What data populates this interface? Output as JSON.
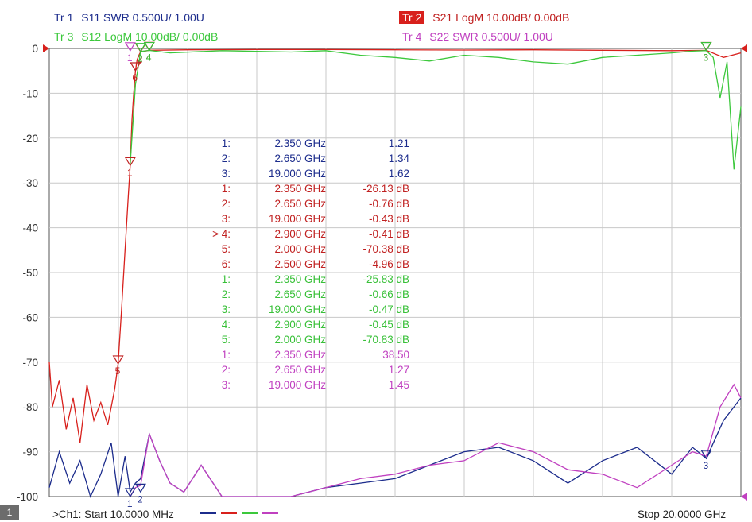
{
  "traces_header": [
    {
      "badge": "Tr",
      "num": "1",
      "label": "S11 SWR 0.500U/ 1.00U",
      "color": "#1c2c8c",
      "active": false
    },
    {
      "badge": "Tr",
      "num": "2",
      "label": "S21 LogM 10.00dB/ 0.00dB",
      "color": "#d8201c",
      "active": true
    },
    {
      "badge": "Tr",
      "num": "3",
      "label": "S12 LogM 10.00dB/ 0.00dB",
      "color": "#3cc83c",
      "active": false
    },
    {
      "badge": "Tr",
      "num": "4",
      "label": "S22 SWR 0.500U/ 1.00U",
      "color": "#c040c0",
      "active": false
    }
  ],
  "markers": [
    {
      "id": "1:",
      "freq": "2.350 GHz",
      "value": "1.21",
      "color": "#1c2c8c"
    },
    {
      "id": "2:",
      "freq": "2.650 GHz",
      "value": "1.34",
      "color": "#1c2c8c"
    },
    {
      "id": "3:",
      "freq": "19.000 GHz",
      "value": "1.62",
      "color": "#1c2c8c"
    },
    {
      "id": "1:",
      "freq": "2.350 GHz",
      "value": "-26.13 dB",
      "color": "#c02020"
    },
    {
      "id": "2:",
      "freq": "2.650 GHz",
      "value": "-0.76 dB",
      "color": "#c02020"
    },
    {
      "id": "3:",
      "freq": "19.000 GHz",
      "value": "-0.43 dB",
      "color": "#c02020"
    },
    {
      "id": "> 4:",
      "freq": "2.900 GHz",
      "value": "-0.41 dB",
      "color": "#c02020"
    },
    {
      "id": "5:",
      "freq": "2.000 GHz",
      "value": "-70.38 dB",
      "color": "#c02020"
    },
    {
      "id": "6:",
      "freq": "2.500 GHz",
      "value": "-4.96 dB",
      "color": "#c02020"
    },
    {
      "id": "1:",
      "freq": "2.350 GHz",
      "value": "-25.83 dB",
      "color": "#38c038"
    },
    {
      "id": "2:",
      "freq": "2.650 GHz",
      "value": "-0.66 dB",
      "color": "#38c038"
    },
    {
      "id": "3:",
      "freq": "19.000 GHz",
      "value": "-0.47 dB",
      "color": "#38c038"
    },
    {
      "id": "4:",
      "freq": "2.900 GHz",
      "value": "-0.45 dB",
      "color": "#38c038"
    },
    {
      "id": "5:",
      "freq": "2.000 GHz",
      "value": "-70.83 dB",
      "color": "#38c038"
    },
    {
      "id": "1:",
      "freq": "2.350 GHz",
      "value": "38.50",
      "color": "#c040c0"
    },
    {
      "id": "2:",
      "freq": "2.650 GHz",
      "value": "1.27",
      "color": "#c040c0"
    },
    {
      "id": "3:",
      "freq": "19.000 GHz",
      "value": "1.45",
      "color": "#c040c0"
    }
  ],
  "footer": {
    "channel_badge": "1",
    "start": ">Ch1:  Start  10.0000 MHz",
    "stop": "Stop  20.0000 GHz"
  },
  "chart_data": {
    "type": "line",
    "title": "",
    "xlabel": "",
    "ylabel": "",
    "x_unit": "GHz",
    "xlim": [
      0.01,
      20
    ],
    "ylim": [
      -100,
      0
    ],
    "yticks": [
      "0",
      "-10",
      "-20",
      "-30",
      "-40",
      "-50",
      "-60",
      "-70",
      "-80",
      "-90",
      "-100"
    ],
    "grid": true,
    "series": [
      {
        "name": "S21",
        "color": "#d8201c",
        "x": [
          0.01,
          0.1,
          0.3,
          0.5,
          0.7,
          0.9,
          1.1,
          1.3,
          1.5,
          1.7,
          1.9,
          2.0,
          2.1,
          2.2,
          2.3,
          2.35,
          2.4,
          2.45,
          2.5,
          2.55,
          2.6,
          2.65,
          2.9,
          4,
          6,
          8,
          10,
          12,
          14,
          16,
          18,
          19,
          19.5,
          20
        ],
        "y": [
          -70,
          -80,
          -74,
          -85,
          -78,
          -88,
          -75,
          -83,
          -79,
          -84,
          -76,
          -70.38,
          -58,
          -45,
          -32,
          -26.13,
          -16,
          -10,
          -4.96,
          -2.5,
          -1.5,
          -0.76,
          -0.41,
          -0.3,
          -0.25,
          -0.25,
          -0.3,
          -0.35,
          -0.3,
          -0.4,
          -0.5,
          -0.43,
          -2,
          -1
        ]
      },
      {
        "name": "S12",
        "color": "#3cc83c",
        "x": [
          2.35,
          2.5,
          2.65,
          2.9,
          3.5,
          5,
          7,
          8,
          9,
          10,
          11,
          12,
          13,
          14,
          15,
          16,
          17,
          18,
          18.6,
          19,
          19.2,
          19.4,
          19.6,
          19.8,
          20
        ],
        "y": [
          -25.83,
          -8,
          -0.66,
          -0.45,
          -1,
          -0.5,
          -0.8,
          -0.5,
          -1.5,
          -2,
          -2.8,
          -1.5,
          -2,
          -3,
          -3.5,
          -2,
          -1.5,
          -1,
          -0.6,
          -0.47,
          -2,
          -11,
          -3,
          -27,
          -13
        ]
      },
      {
        "name": "S11",
        "color": "#1c2c8c",
        "x": [
          0.01,
          0.3,
          0.6,
          0.9,
          1.2,
          1.5,
          1.8,
          2.0,
          2.2,
          2.35,
          2.5,
          2.65,
          2.9,
          3.2,
          3.5,
          3.9,
          4.4,
          5,
          6,
          7,
          8,
          9,
          10,
          11,
          12,
          13,
          14,
          15,
          16,
          17,
          18,
          18.6,
          19,
          19.5,
          20
        ],
        "y": [
          -98,
          -90,
          -97,
          -92,
          -100,
          -95,
          -88,
          -100,
          -91,
          -99,
          -97,
          -96,
          -86,
          -92,
          -97,
          -99,
          -93,
          -100,
          -100,
          -100,
          -98,
          -97,
          -96,
          -93,
          -90,
          -89,
          -92,
          -97,
          -92,
          -89,
          -95,
          -89,
          -91.5,
          -83,
          -78
        ]
      },
      {
        "name": "S22",
        "color": "#c040c0",
        "x": [
          2.35,
          2.5,
          2.65,
          2.9,
          3.2,
          3.5,
          3.9,
          4.4,
          5,
          6,
          7,
          8,
          9,
          10,
          11,
          12,
          13,
          14,
          15,
          16,
          17,
          18,
          18.6,
          19,
          19.4,
          19.8,
          20
        ],
        "y": [
          -100,
          -98,
          -97.5,
          -86,
          -92,
          -97,
          -99,
          -93,
          -100,
          -100,
          -100,
          -98,
          -96,
          -95,
          -93,
          -92,
          -88,
          -90,
          -94,
          -95,
          -98,
          -93,
          -90,
          -91,
          -80,
          -75,
          -78
        ]
      }
    ],
    "marker_points": [
      {
        "label": "1",
        "x": 2.35,
        "y": -26.13,
        "color": "#c02020"
      },
      {
        "label": "2",
        "x": 2.65,
        "y": -0.76,
        "color": "#c02020"
      },
      {
        "label": "3",
        "x": 19.0,
        "y": -0.43,
        "color": "#c02020"
      },
      {
        "label": "4",
        "x": 2.9,
        "y": -0.41,
        "color": "#c02020"
      },
      {
        "label": "5",
        "x": 2.0,
        "y": -70.38,
        "color": "#c02020"
      },
      {
        "label": "6",
        "x": 2.5,
        "y": -4.96,
        "color": "#c02020"
      },
      {
        "label": "2",
        "x": 2.65,
        "y": -0.66,
        "color": "#38c038"
      },
      {
        "label": "3",
        "x": 19.0,
        "y": -0.47,
        "color": "#38c038"
      },
      {
        "label": "4",
        "x": 2.9,
        "y": -0.45,
        "color": "#38c038"
      },
      {
        "label": "1",
        "x": 2.35,
        "y": -100,
        "color": "#1c2c8c"
      },
      {
        "label": "2",
        "x": 2.65,
        "y": -99,
        "color": "#1c2c8c"
      },
      {
        "label": "3",
        "x": 19.0,
        "y": -91.5,
        "color": "#1c2c8c"
      },
      {
        "label": "1",
        "x": 2.35,
        "y": -0.5,
        "color": "#c040c0"
      }
    ]
  }
}
